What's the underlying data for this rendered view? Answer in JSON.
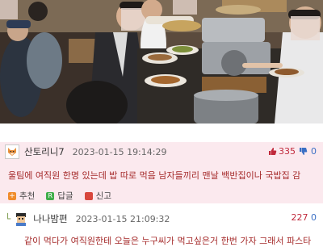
{
  "comment": {
    "nickname": "산토리니7",
    "date": "2023-01-15 19:14:29",
    "upvotes": "335",
    "downvotes": "0",
    "text": "울팀에 여직원 한명 있는데 밥 따로 먹음 남자들끼리 맨날 백반집이나 국밥집 감",
    "actions": {
      "recommend": "추천",
      "reply": "답글",
      "report": "신고"
    }
  },
  "reply": {
    "nickname": "나나밤편",
    "date": "2023-01-15 21:09:32",
    "upvotes": "227",
    "downvotes": "0",
    "text": "같이 먹다가 여직원한테 오늘은 누구씨가 먹고싶은거 한번 가자 그래서 파스타"
  },
  "colors": {
    "comment_bg": "#fbe9ee",
    "comment_text": "#a52a2a",
    "upvote": "#c0293b",
    "downvote": "#3a6fc4"
  },
  "icons": {
    "upvote": "thumbs-up-icon",
    "downvote": "thumbs-down-icon",
    "recommend": "plus-icon",
    "reply": "reply-icon",
    "report": "report-icon",
    "reply_marker": "reply-arrow-icon"
  }
}
